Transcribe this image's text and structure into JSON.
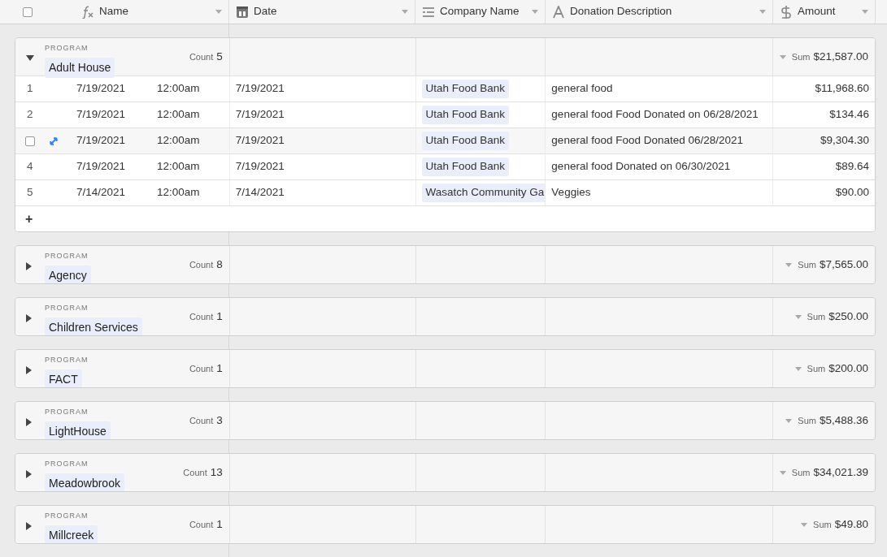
{
  "select_all_checked": false,
  "columns": [
    {
      "label": "Name",
      "kind": "formula"
    },
    {
      "label": "Date",
      "kind": "date"
    },
    {
      "label": "Company Name",
      "kind": "link"
    },
    {
      "label": "Donation Description",
      "kind": "text"
    },
    {
      "label": "Amount",
      "kind": "currency"
    }
  ],
  "groups": [
    {
      "field": "PROGRAM",
      "name": "Adult House",
      "count_label": "Count",
      "count": "5",
      "sum_label": "Sum",
      "sum": "$21,587.00",
      "expanded": true,
      "rows": [
        {
          "number": "1",
          "hovered": false,
          "name_date": "7/19/2021",
          "name_time": "12:00am",
          "date": "7/19/2021",
          "company": "Utah Food Bank",
          "description": "general food",
          "amount": "$11,968.60"
        },
        {
          "number": "2",
          "hovered": false,
          "name_date": "7/19/2021",
          "name_time": "12:00am",
          "date": "7/19/2021",
          "company": "Utah Food Bank",
          "description": "general food Food Donated on 06/28/2021",
          "amount": "$134.46"
        },
        {
          "hovered": true,
          "name_date": "7/19/2021",
          "name_time": "12:00am",
          "date": "7/19/2021",
          "company": "Utah Food Bank",
          "description": "general food Food Donated 06/28/2021",
          "amount": "$9,304.30"
        },
        {
          "number": "4",
          "hovered": false,
          "name_date": "7/19/2021",
          "name_time": "12:00am",
          "date": "7/19/2021",
          "company": "Utah Food Bank",
          "description": "general food Donated on 06/30/2021",
          "amount": "$89.64"
        },
        {
          "number": "5",
          "hovered": false,
          "name_date": "7/14/2021",
          "name_time": "12:00am",
          "date": "7/14/2021",
          "company": "Wasatch Community Ga",
          "description": "Veggies",
          "amount": "$90.00"
        }
      ],
      "add_label": "+"
    },
    {
      "field": "PROGRAM",
      "name": "Agency",
      "count_label": "Count",
      "count": "8",
      "sum_label": "Sum",
      "sum": "$7,565.00",
      "expanded": false
    },
    {
      "field": "PROGRAM",
      "name": "Children Services",
      "count_label": "Count",
      "count": "1",
      "sum_label": "Sum",
      "sum": "$250.00",
      "expanded": false
    },
    {
      "field": "PROGRAM",
      "name": "FACT",
      "count_label": "Count",
      "count": "1",
      "sum_label": "Sum",
      "sum": "$200.00",
      "expanded": false
    },
    {
      "field": "PROGRAM",
      "name": "LightHouse",
      "count_label": "Count",
      "count": "3",
      "sum_label": "Sum",
      "sum": "$5,488.36",
      "expanded": false
    },
    {
      "field": "PROGRAM",
      "name": "Meadowbrook",
      "count_label": "Count",
      "count": "13",
      "sum_label": "Sum",
      "sum": "$34,021.39",
      "expanded": false
    },
    {
      "field": "PROGRAM",
      "name": "Millcreek",
      "count_label": "Count",
      "count": "1",
      "sum_label": "Sum",
      "sum": "$49.80",
      "expanded": false
    }
  ]
}
